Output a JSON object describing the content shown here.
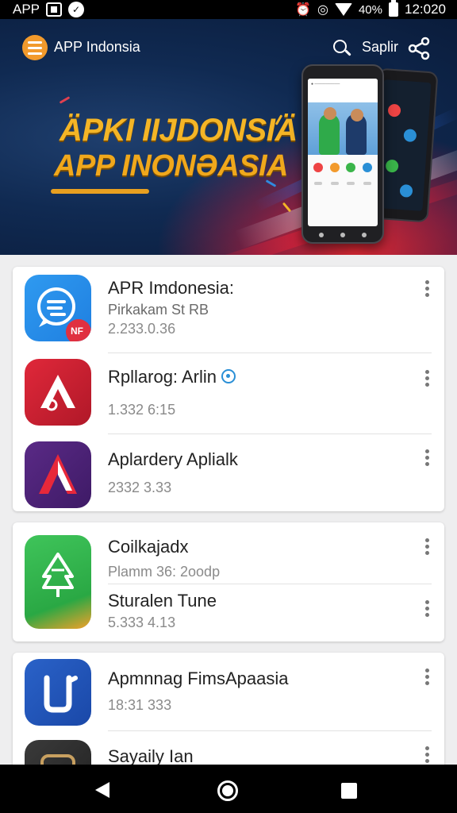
{
  "status_bar": {
    "left_label": "APP",
    "left_icons": [
      "notification-box-icon",
      "app-badge-icon"
    ],
    "right_icons": [
      "alarm-icon",
      "hotspot-icon",
      "wifi-icon"
    ],
    "battery": "40%",
    "time": "12:020"
  },
  "header": {
    "menu_icon": "hamburger-icon",
    "title": "APP Indonsia",
    "search_icon": "search-icon",
    "search_label": "Saplir",
    "share_icon": "share-icon"
  },
  "banner": {
    "line1": "ÄPKI IIJDONSIÄ",
    "line2": "APP INONƏASIA",
    "accent_color": "#f4b526"
  },
  "groups": [
    {
      "items": [
        {
          "name": "APR Imdonesia:",
          "subtitle": "Pirkakam St RB",
          "meta": "2.233.0.36",
          "icon": "blue-chat-app-icon",
          "badge": "NF"
        },
        {
          "name": "Rpllarog: Arlin",
          "verified": true,
          "meta": "1.332 6:15",
          "icon": "red-a-app-icon"
        },
        {
          "name": "Aplardery Aplialk",
          "meta": "2332 3.33",
          "icon": "purple-a-app-icon"
        }
      ]
    },
    {
      "items": [
        {
          "name": "Coilkajadx",
          "subtitle": "Plamm 36: 2oodp",
          "icon": "green-cloud-app-icon"
        },
        {
          "name": "Sturalen Tune",
          "meta": "5.333 4.13"
        }
      ]
    },
    {
      "items": [
        {
          "name": "Apmnnag FimsApaasia",
          "meta": "18:31 333",
          "icon": "blue-j-app-icon"
        },
        {
          "name": "Sayaily Ian",
          "icon": "dark-app-icon"
        }
      ]
    }
  ],
  "nav": {
    "back": "back-icon",
    "home": "home-icon",
    "recents": "recents-icon"
  }
}
